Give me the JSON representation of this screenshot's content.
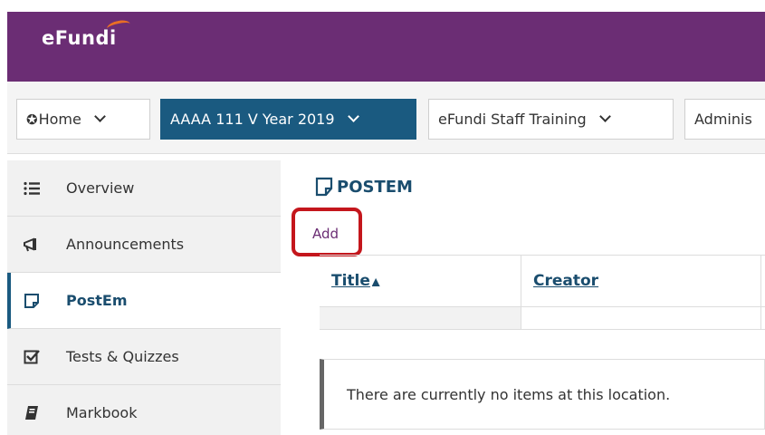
{
  "header": {
    "logo_text": "eFundi",
    "bg_color": "#6b2d74"
  },
  "site_nav": {
    "tabs": [
      {
        "label": "Home",
        "icon": "home-icon",
        "active": false
      },
      {
        "label": "AAAA 111 V Year 2019",
        "active": true
      },
      {
        "label": "eFundi Staff Training",
        "active": false
      },
      {
        "label": "Adminis",
        "active": false
      }
    ],
    "active_color": "#1a5a80"
  },
  "sidebar": {
    "items": [
      {
        "label": "Overview",
        "icon": "list-icon"
      },
      {
        "label": "Announcements",
        "icon": "megaphone-icon"
      },
      {
        "label": "PostEm",
        "icon": "note-icon",
        "active": true
      },
      {
        "label": "Tests & Quizzes",
        "icon": "checkbox-icon"
      },
      {
        "label": "Markbook",
        "icon": "book-icon"
      }
    ]
  },
  "main": {
    "title": "POSTEM",
    "add_label": "Add",
    "table": {
      "columns": [
        "Title",
        "Creator"
      ]
    },
    "empty_message": "There are currently no items at this location."
  },
  "highlight_color": "#c4161c"
}
